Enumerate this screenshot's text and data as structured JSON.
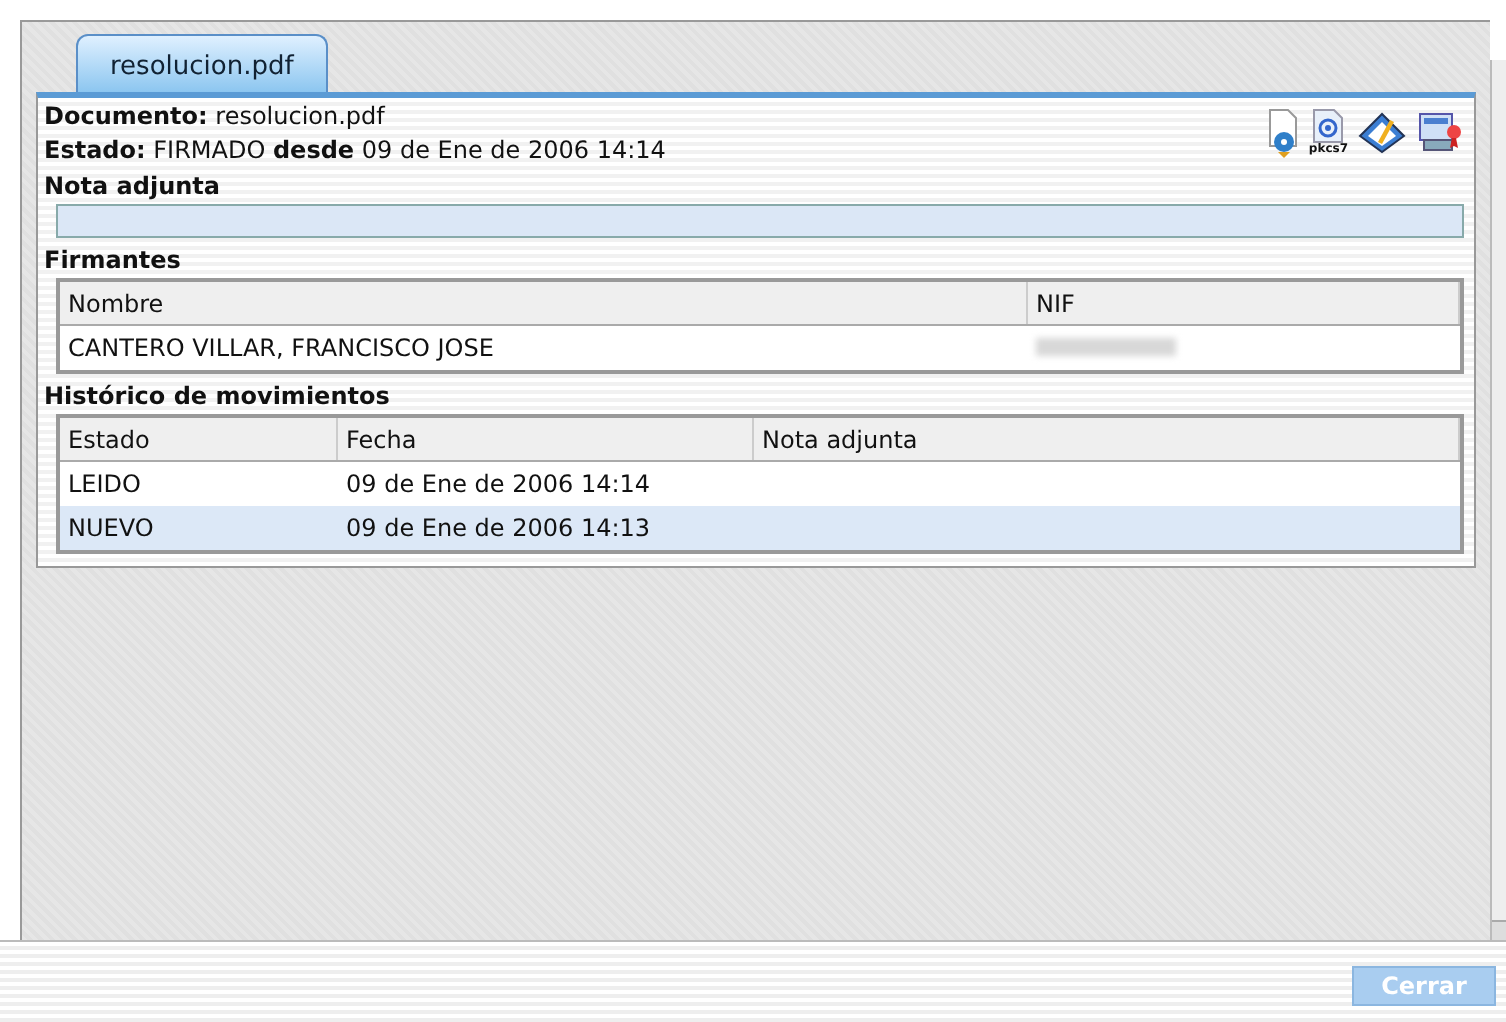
{
  "tab": {
    "label": "resolucion.pdf",
    "selected": true
  },
  "document_line": "**Documento:** resolucion.pdf",
  "status_line": "**Estado:** FIRMADO **desde** 09 de Ene de 2006 14:14",
  "toolbar_icons": [
    {
      "kind": "disc"
    },
    {
      "kind": "pkcs7",
      "label": "pkcs7"
    },
    {
      "kind": "sign"
    },
    {
      "kind": "cert"
    }
  ],
  "note": {
    "title": "Nota adjunta"
  },
  "signers": {
    "title": "Firmantes",
    "columns": [
      "Nombre",
      "NIF"
    ],
    "rows": [
      {
        "cells": [
          {
            "text": "CANTERO VILLAR, FRANCISCO JOSE"
          },
          {
            "redacted": true
          }
        ],
        "selected": false
      }
    ]
  },
  "history": {
    "title": "Histórico de movimientos",
    "columns": [
      "Estado",
      "Fecha",
      "Nota adjunta"
    ],
    "rows": [
      {
        "cells": [
          {
            "text": "LEIDO"
          },
          {
            "text": "09 de Ene de 2006 14:14"
          }
        ],
        "selected": false
      },
      {
        "cells": [
          {
            "text": "NUEVO"
          },
          {
            "text": "09 de Ene de 2006 14:13"
          }
        ],
        "selected": true
      }
    ]
  },
  "close_button": {
    "label": "Cerrar",
    "disabled": true
  }
}
